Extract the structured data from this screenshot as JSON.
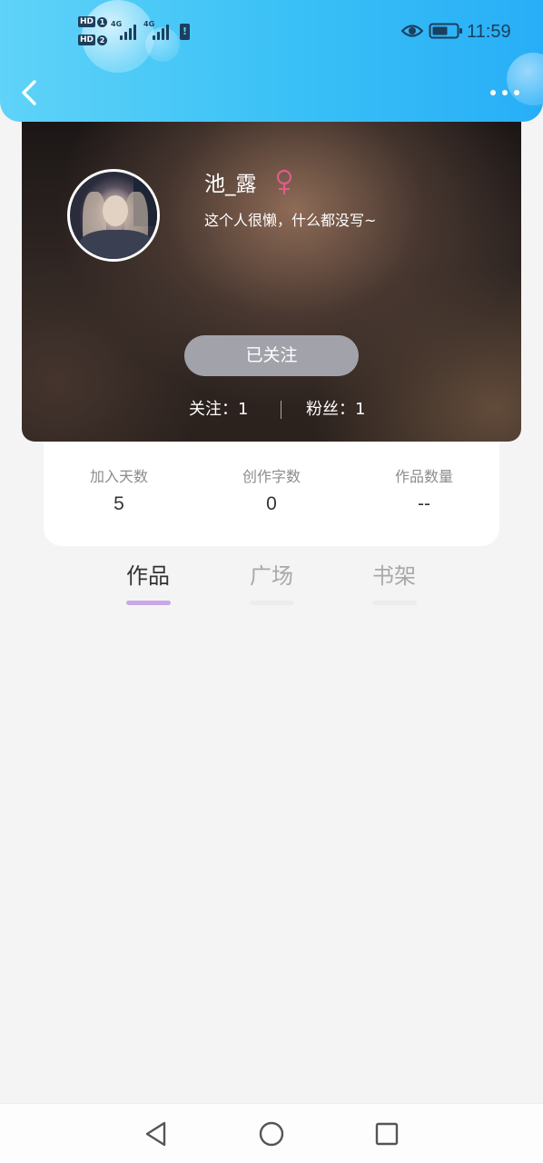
{
  "status_bar": {
    "sim1": "HD",
    "sim1_slot": "1",
    "sim2": "HD",
    "sim2_slot": "2",
    "network_1": "4G",
    "network_2": "4G",
    "time": "11:59",
    "icons": [
      "signal-icon",
      "battery-alert-icon",
      "eye-icon",
      "battery-icon"
    ]
  },
  "nav": {
    "back_icon": "chevron-left-icon",
    "more_icon": "more-dots-icon"
  },
  "profile": {
    "name": "池_露",
    "gender_symbol": "♀",
    "gender_color": "#e05c8a",
    "bio": "这个人很懒，什么都没写~",
    "follow_button_label": "已关注",
    "following_label": "关注：",
    "following_count": "1",
    "followers_label": "粉丝：",
    "followers_count": "1"
  },
  "stats": [
    {
      "label": "加入天数",
      "value": "5"
    },
    {
      "label": "创作字数",
      "value": "0"
    },
    {
      "label": "作品数量",
      "value": "--"
    }
  ],
  "tabs": [
    {
      "label": "作品",
      "active": true
    },
    {
      "label": "广场",
      "active": false
    },
    {
      "label": "书架",
      "active": false
    }
  ],
  "colors": {
    "header_gradient_start": "#5fd3f8",
    "header_gradient_end": "#28aef7",
    "active_tab_underline": "#c9a8e8",
    "follow_button": "#a2a2aa",
    "page_background": "#f4f4f4"
  },
  "system_nav": [
    "back-triangle-icon",
    "home-circle-icon",
    "recent-square-icon"
  ]
}
